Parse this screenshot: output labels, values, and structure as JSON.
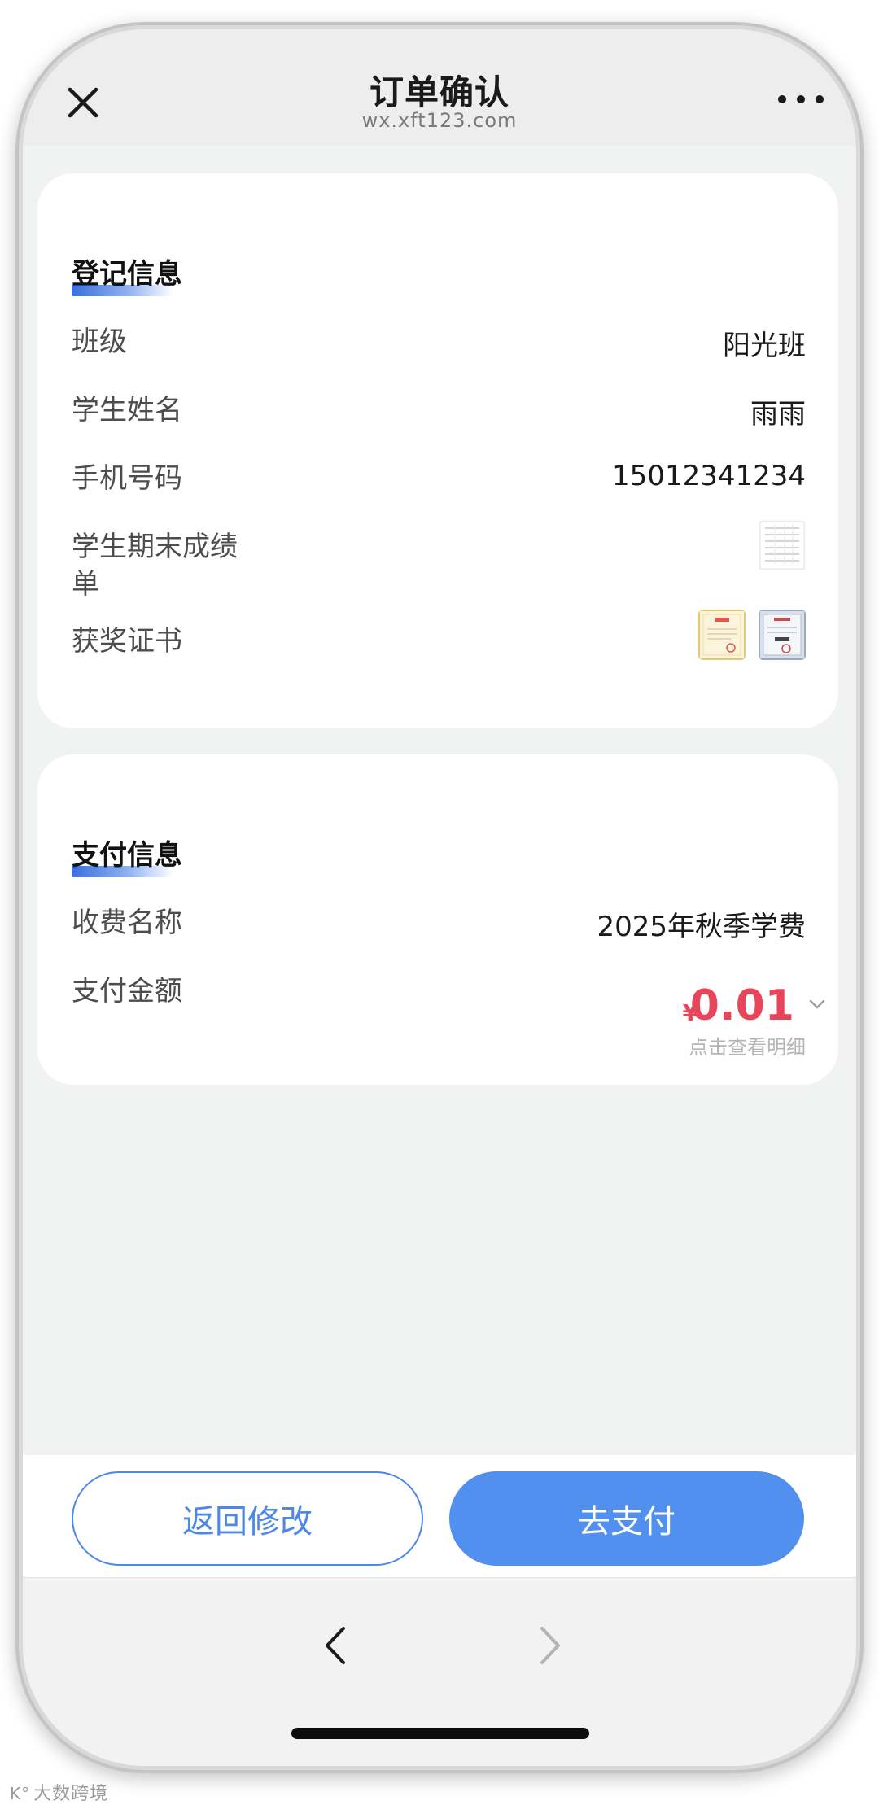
{
  "header": {
    "title": "订单确认",
    "domain": "wx.xft123.com",
    "close_icon": "close-icon",
    "more_icon": "more-icon"
  },
  "registration": {
    "section_title": "登记信息",
    "fields": [
      {
        "label": "班级",
        "value": "阳光班"
      },
      {
        "label": "学生姓名",
        "value": "雨雨"
      },
      {
        "label": "手机号码",
        "value": "15012341234"
      }
    ],
    "transcript_label_line1": "学生期末成绩",
    "transcript_label_line2": "单",
    "awards_label": "获奖证书"
  },
  "payment": {
    "section_title": "支付信息",
    "fee_name_label": "收费名称",
    "fee_name_value": "2025年秋季学费",
    "amount_label": "支付金额",
    "currency_symbol": "¥",
    "amount_value": "0.01",
    "detail_link": "点击查看明细"
  },
  "actions": {
    "back_label": "返回修改",
    "pay_label": "去支付"
  },
  "browser": {
    "back_icon": "chevron-left-icon",
    "forward_icon": "chevron-right-icon"
  },
  "watermark": {
    "text": "大数跨境"
  },
  "colors": {
    "accent": "#5190ee",
    "amount": "#e8455a",
    "page_bg": "#f1f2f2"
  }
}
